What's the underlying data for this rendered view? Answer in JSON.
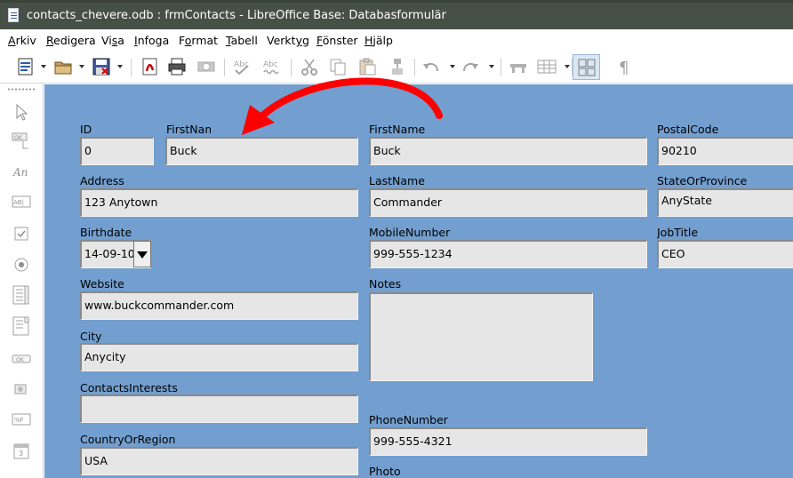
{
  "window": {
    "title": "contacts_chevere.odb : frmContacts - LibreOffice Base: Databasformulär"
  },
  "menu": {
    "items": [
      {
        "u": "A",
        "rest": "rkiv"
      },
      {
        "u": "R",
        "rest": "edigera"
      },
      {
        "pre": "Vi",
        "u": "s",
        "rest": "a"
      },
      {
        "u": "I",
        "rest": "nfoga"
      },
      {
        "pre": "F",
        "u": "o",
        "rest": "rmat"
      },
      {
        "u": "T",
        "rest": "abell"
      },
      {
        "pre": "Verkt",
        "u": "y",
        "rest": "g"
      },
      {
        "u": "F",
        "rest": "önster"
      },
      {
        "pre": "",
        "u": "H",
        "rest": "jälp"
      }
    ]
  },
  "toolbar": {
    "icons": [
      "new-document-icon",
      "open-folder-icon",
      "save-icon",
      "export-pdf-icon",
      "print-icon",
      "print-preview-icon",
      "spellcheck-icon",
      "autospellcheck-icon",
      "cut-icon",
      "copy-icon",
      "paste-icon",
      "clone-formatting-icon",
      "undo-icon",
      "redo-icon",
      "navigator-icon",
      "table-icon",
      "design-mode-icon",
      "formatting-marks-icon"
    ]
  },
  "form": {
    "id": {
      "label": "ID",
      "value": "0"
    },
    "firstname_short": {
      "label": "FirstNam",
      "value": "Buck"
    },
    "firstname": {
      "label": "FirstName",
      "value": "Buck"
    },
    "postalcode": {
      "label": "PostalCode",
      "value": "90210"
    },
    "address": {
      "label": "Address",
      "value": "123 Anytown"
    },
    "lastname": {
      "label": "LastName",
      "value": "Commander"
    },
    "stateorprovince": {
      "label": "StateOrProvince",
      "value": "AnyState"
    },
    "birthdate": {
      "label": "Birthdate",
      "value": "14-09-10"
    },
    "mobilenumber": {
      "label": "MobileNumber",
      "value": "999-555-1234"
    },
    "jobtitle": {
      "label": "JobTitle",
      "value": "CEO"
    },
    "website": {
      "label": "Website",
      "value": "www.buckcommander.com"
    },
    "notes": {
      "label": "Notes",
      "value": ""
    },
    "city": {
      "label": "City",
      "value": "Anycity"
    },
    "contactsinterests": {
      "label": "ContactsInterests",
      "value": ""
    },
    "phonenumber": {
      "label": "PhoneNumber",
      "value": "999-555-4321"
    },
    "countryorregion": {
      "label": "CountryOrRegion",
      "value": "USA"
    },
    "photo": {
      "label": "Photo"
    }
  },
  "colors": {
    "form_background": "#729fcf",
    "field_background": "#e6e6e6",
    "titlebar": "#465046",
    "annotation_arrow": "#ff0000"
  }
}
